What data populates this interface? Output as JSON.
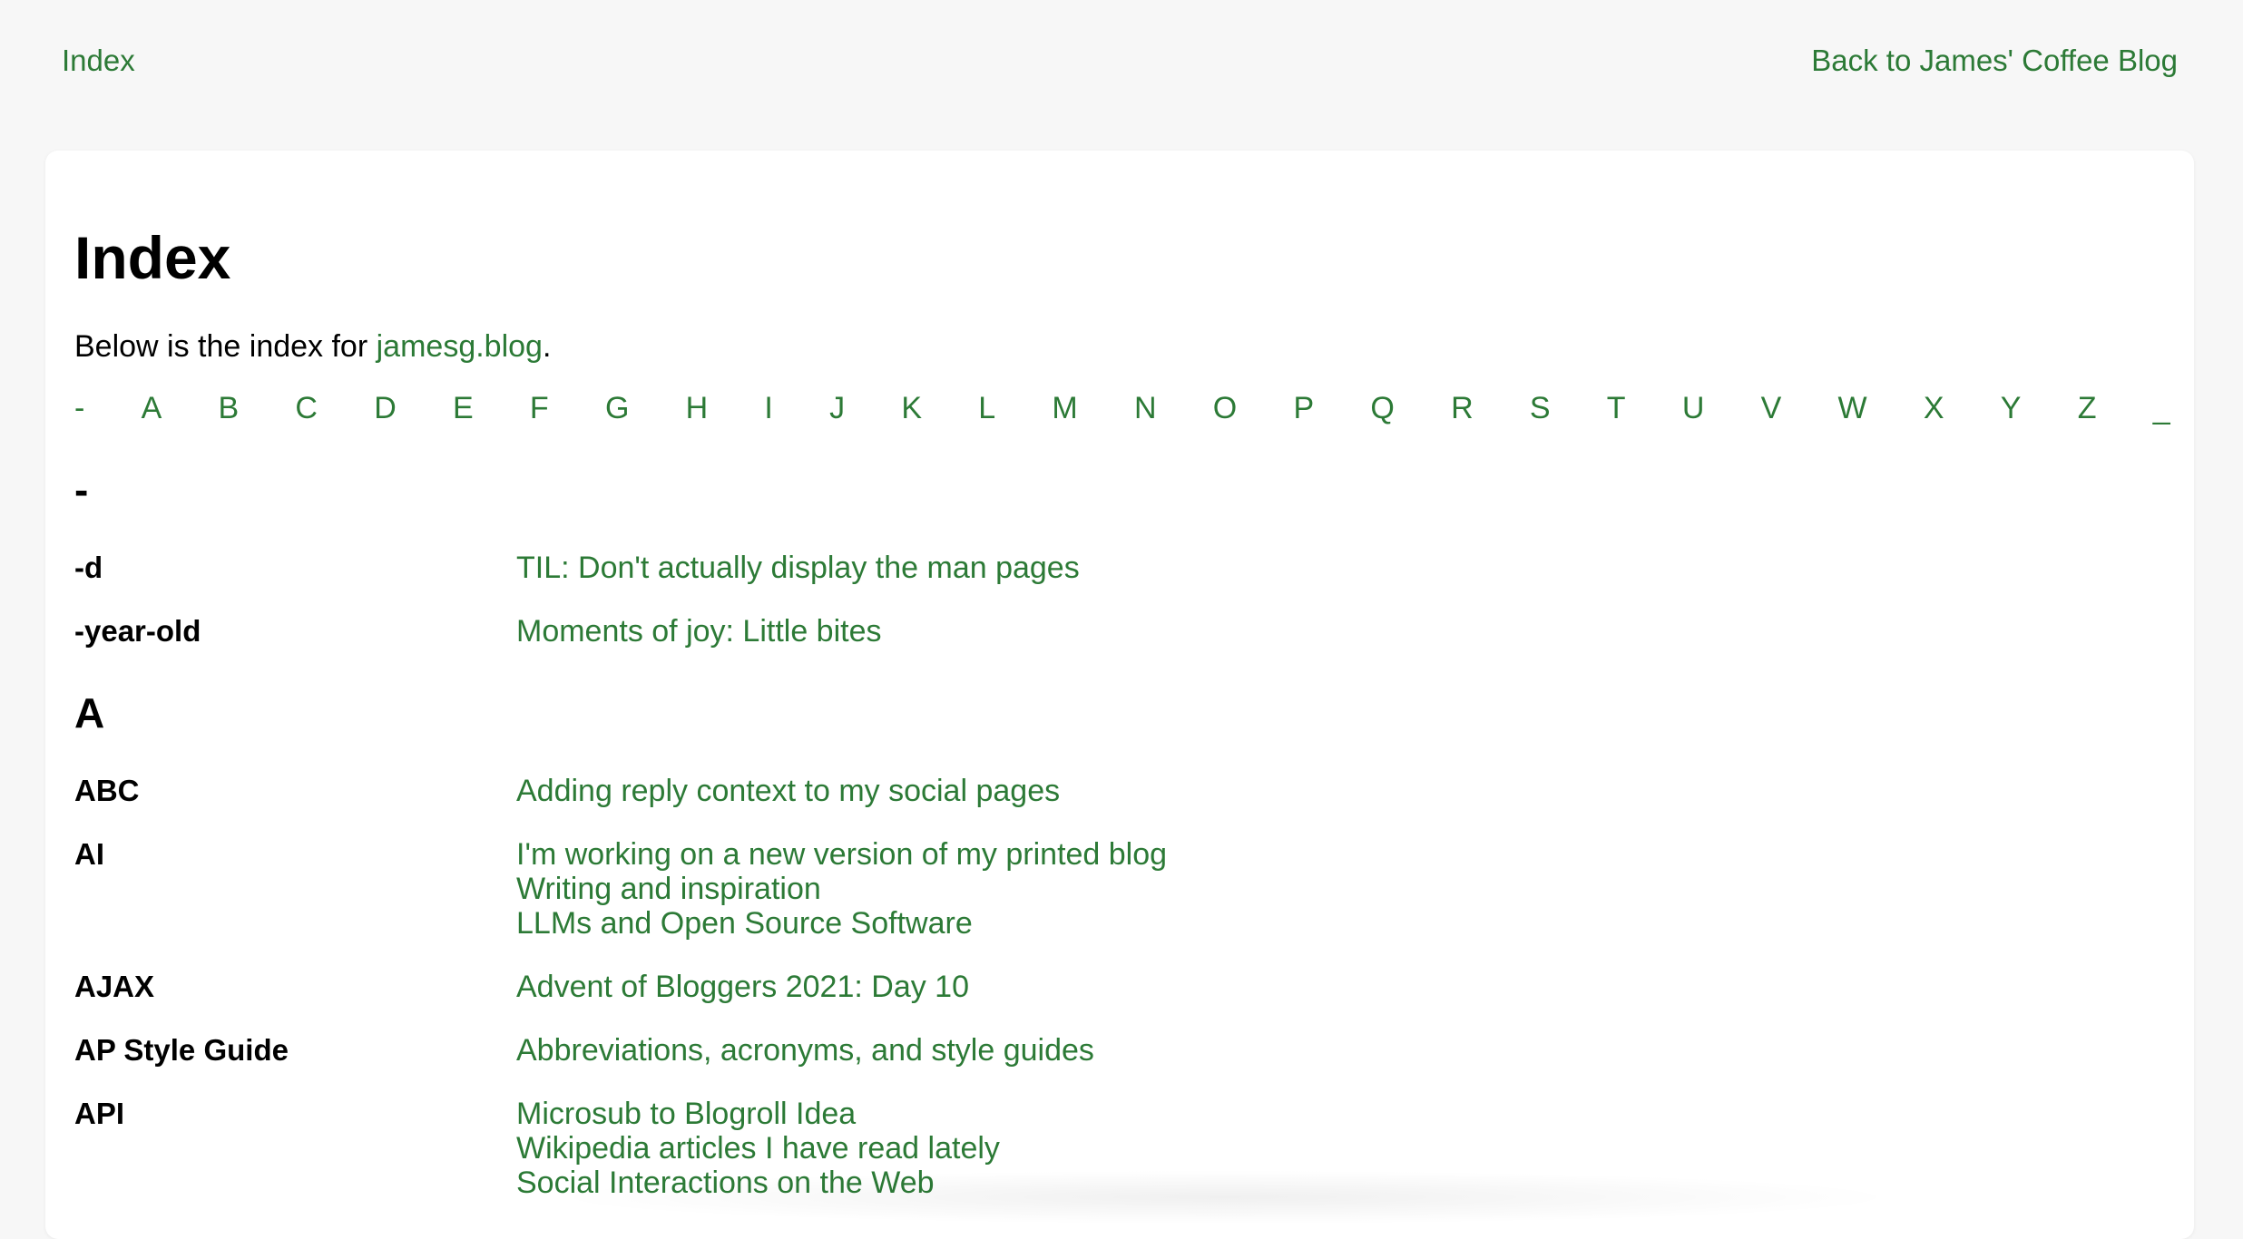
{
  "nav": {
    "left_link": "Index",
    "right_link": "Back to James' Coffee Blog"
  },
  "page": {
    "title": "Index",
    "intro_prefix": "Below is the index for ",
    "intro_link": "jamesg.blog",
    "intro_suffix": "."
  },
  "alphabet": [
    "-",
    "A",
    "B",
    "C",
    "D",
    "E",
    "F",
    "G",
    "H",
    "I",
    "J",
    "K",
    "L",
    "M",
    "N",
    "O",
    "P",
    "Q",
    "R",
    "S",
    "T",
    "U",
    "V",
    "W",
    "X",
    "Y",
    "Z",
    "_"
  ],
  "sections": [
    {
      "heading": "-",
      "entries": [
        {
          "term": "-d",
          "links": [
            "TIL: Don't actually display the man pages"
          ]
        },
        {
          "term": "-year-old",
          "links": [
            "Moments of joy: Little bites"
          ]
        }
      ]
    },
    {
      "heading": "A",
      "entries": [
        {
          "term": "ABC",
          "links": [
            "Adding reply context to my social pages"
          ]
        },
        {
          "term": "AI",
          "links": [
            "I'm working on a new version of my printed blog",
            "Writing and inspiration",
            "LLMs and Open Source Software"
          ]
        },
        {
          "term": "AJAX",
          "links": [
            "Advent of Bloggers 2021: Day 10"
          ]
        },
        {
          "term": "AP Style Guide",
          "links": [
            "Abbreviations, acronyms, and style guides"
          ]
        },
        {
          "term": "API",
          "links": [
            "Microsub to Blogroll Idea",
            "Wikipedia articles I have read lately",
            "Social Interactions on the Web"
          ]
        }
      ]
    }
  ]
}
